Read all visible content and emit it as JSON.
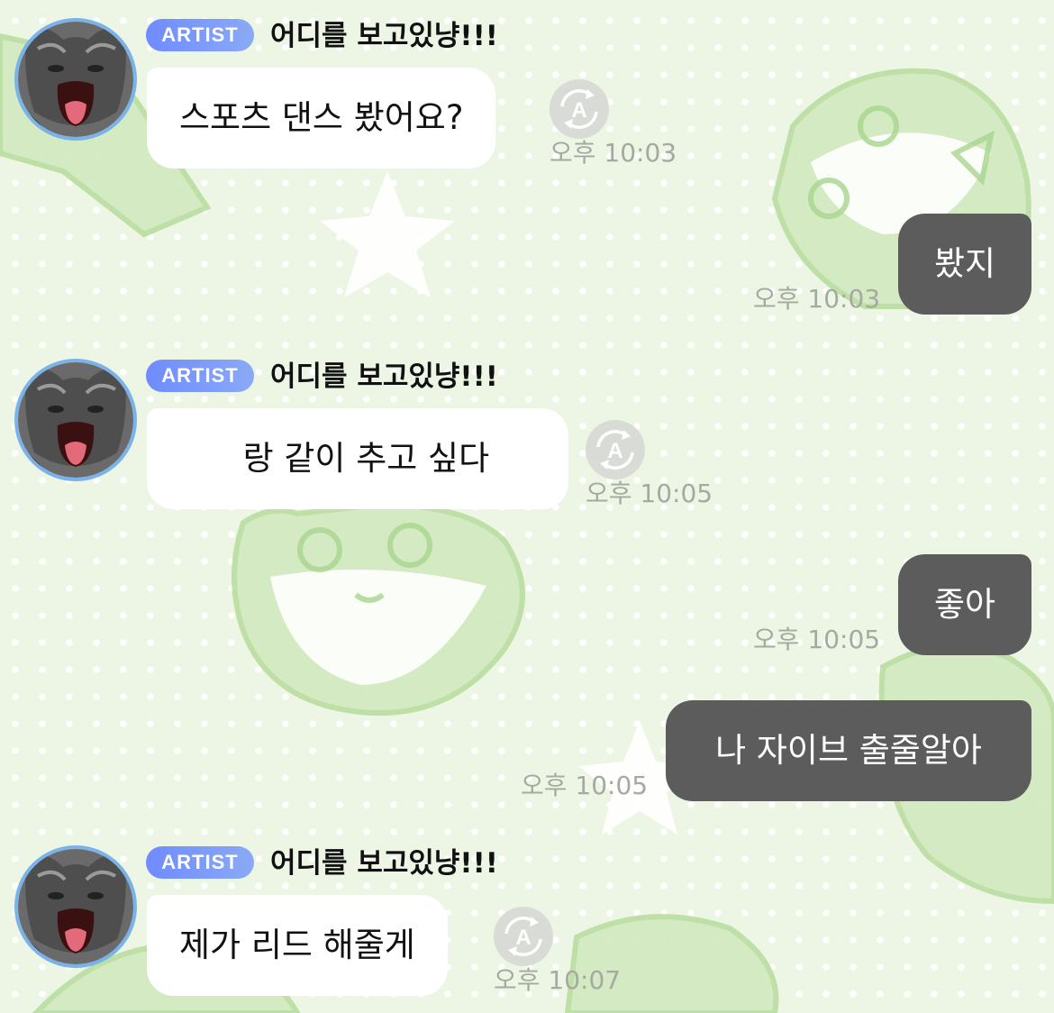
{
  "colors": {
    "background": "#edf6e4",
    "incoming_bubble": "#ffffff",
    "outgoing_bubble": "#5c5c5c",
    "badge_gradient_start": "#6f8bff",
    "badge_gradient_end": "#8aaaf6",
    "timestamp_text": "#a4a9a1",
    "avatar_ring": "#7ab3ea"
  },
  "messages": [
    {
      "type": "incoming",
      "badge": "ARTIST",
      "sender": "어디를 보고있냥!!!",
      "text": "스포츠 댄스 봤어요?",
      "time": "오후 10:03",
      "icons": [
        "cat-avatar-icon",
        "translate-icon"
      ]
    },
    {
      "type": "outgoing",
      "text": "봤지",
      "time": "오후 10:03"
    },
    {
      "type": "incoming",
      "badge": "ARTIST",
      "sender": "어디를 보고있냥!!!",
      "text": "      랑 같이 추고 싶다",
      "time": "오후 10:05",
      "icons": [
        "cat-avatar-icon",
        "translate-icon"
      ]
    },
    {
      "type": "outgoing",
      "text": "좋아",
      "time": "오후 10:05"
    },
    {
      "type": "outgoing",
      "text": "나 자이브 출줄알아",
      "time": "오후 10:05"
    },
    {
      "type": "incoming",
      "badge": "ARTIST",
      "sender": "어디를 보고있냥!!!",
      "text": "제가 리드 해줄게",
      "time": "오후 10:07",
      "icons": [
        "cat-avatar-icon",
        "translate-icon"
      ]
    }
  ]
}
